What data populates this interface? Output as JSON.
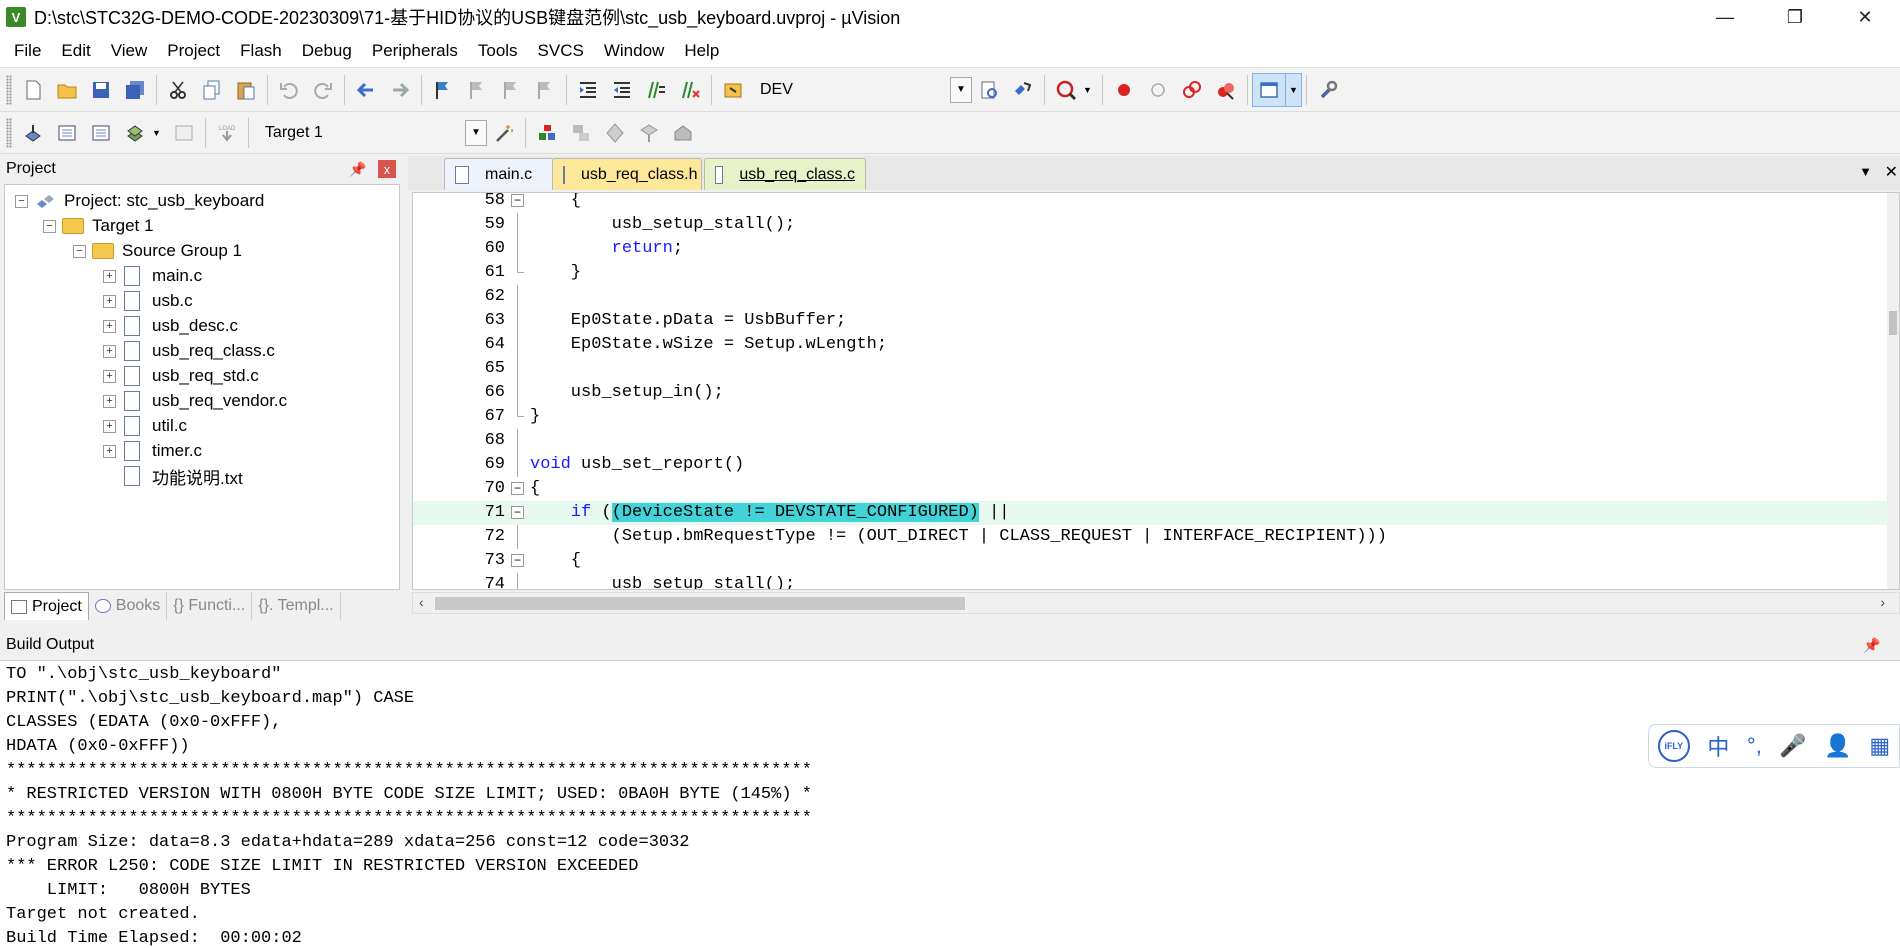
{
  "window": {
    "title": "D:\\stc\\STC32G-DEMO-CODE-20230309\\71-基于HID协议的USB键盘范例\\stc_usb_keyboard.uvproj - µVision",
    "icon_label": "V",
    "minimize": "—",
    "restore": "❐",
    "close": "✕"
  },
  "menu": [
    "File",
    "Edit",
    "View",
    "Project",
    "Flash",
    "Debug",
    "Peripherals",
    "Tools",
    "SVCS",
    "Window",
    "Help"
  ],
  "toolbar": {
    "device_label": "DEV",
    "target_label": "Target 1"
  },
  "project_panel": {
    "title": "Project",
    "pin": "📌",
    "close": "x",
    "tree": {
      "project": "Project: stc_usb_keyboard",
      "target": "Target 1",
      "group": "Source Group 1",
      "files": [
        "main.c",
        "usb.c",
        "usb_desc.c",
        "usb_req_class.c",
        "usb_req_std.c",
        "usb_req_vendor.c",
        "util.c",
        "timer.c",
        "功能说明.txt"
      ]
    },
    "tabs": [
      "Project",
      "Books",
      "{} Functi...",
      "{}. Templ..."
    ]
  },
  "editor": {
    "tabs": [
      "main.c",
      "usb_req_class.h",
      "usb_req_class.c"
    ],
    "active_tab": "usb_req_class.c",
    "tab_menu": "▼",
    "tab_close": "✕",
    "lines": [
      {
        "n": "58",
        "pre": "    {",
        "kw": "",
        "post": ""
      },
      {
        "n": "59",
        "pre": "        usb_setup_stall();",
        "kw": "",
        "post": ""
      },
      {
        "n": "60",
        "pre": "        ",
        "kw": "return",
        "post": ";"
      },
      {
        "n": "61",
        "pre": "    }",
        "kw": "",
        "post": ""
      },
      {
        "n": "62",
        "pre": "",
        "kw": "",
        "post": ""
      },
      {
        "n": "63",
        "pre": "    Ep0State.pData = UsbBuffer;",
        "kw": "",
        "post": ""
      },
      {
        "n": "64",
        "pre": "    Ep0State.wSize = Setup.wLength;",
        "kw": "",
        "post": ""
      },
      {
        "n": "65",
        "pre": "",
        "kw": "",
        "post": ""
      },
      {
        "n": "66",
        "pre": "    usb_setup_in();",
        "kw": "",
        "post": ""
      },
      {
        "n": "67",
        "pre": "}",
        "kw": "",
        "post": ""
      },
      {
        "n": "68",
        "pre": "",
        "kw": "",
        "post": ""
      },
      {
        "n": "69",
        "pre": "",
        "kw": "void",
        "post": " usb_set_report()"
      },
      {
        "n": "70",
        "pre": "{",
        "kw": "",
        "post": ""
      },
      {
        "n": "71",
        "pre": "    ",
        "kw": "if",
        "post": " (",
        "hl": "(DeviceState != DEVSTATE_CONFIGURED)",
        "tail": " ||"
      },
      {
        "n": "72",
        "pre": "        (Setup.bmRequestType != (OUT_DIRECT | CLASS_REQUEST | INTERFACE_RECIPIENT)))",
        "kw": "",
        "post": ""
      },
      {
        "n": "73",
        "pre": "    {",
        "kw": "",
        "post": ""
      },
      {
        "n": "74",
        "pre": "        usb_setup_stall();",
        "kw": "",
        "post": ""
      }
    ]
  },
  "build_output": {
    "title": "Build Output",
    "lines": [
      "TO \".\\obj\\stc_usb_keyboard\"",
      "PRINT(\".\\obj\\stc_usb_keyboard.map\") CASE",
      "CLASSES (EDATA (0x0-0xFFF),",
      "HDATA (0x0-0xFFF))",
      "*******************************************************************************",
      "* RESTRICTED VERSION WITH 0800H BYTE CODE SIZE LIMIT; USED: 0BA0H BYTE (145%) *",
      "*******************************************************************************",
      "Program Size: data=8.3 edata+hdata=289 xdata=256 const=12 code=3032",
      "*** ERROR L250: CODE SIZE LIMIT IN RESTRICTED VERSION EXCEEDED",
      "    LIMIT:   0800H BYTES",
      "Target not created.",
      "Build Time Elapsed:  00:00:02"
    ]
  },
  "ime": {
    "logo": "iFLY",
    "lang": "中",
    "punct": "°,",
    "mic": "🎤",
    "user": "👤",
    "grid": "▦"
  }
}
